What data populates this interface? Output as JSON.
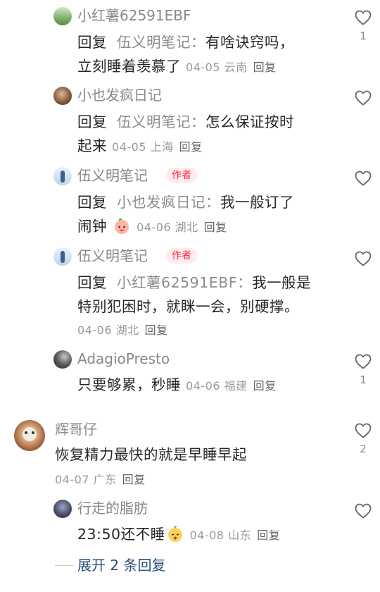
{
  "comments": [
    {
      "name": "小红薯62591EBF",
      "reply_word": "回复",
      "reply_to": "伍义明笔记",
      "line1_text": "有啥诀窍吗，",
      "line2_text": "立刻睡着羡慕了",
      "meta": "04-05 云南",
      "reply_btn": "回复",
      "likes": "1"
    },
    {
      "name": "小也发疯日记",
      "reply_word": "回复",
      "reply_to": "伍义明笔记",
      "line1_text": "怎么保证按时",
      "line2_text": "起来",
      "meta": "04-05 上海",
      "reply_btn": "回复",
      "likes": ""
    },
    {
      "name": "伍义明笔记",
      "badge": "作者",
      "reply_word": "回复",
      "reply_to": "小也发疯日记",
      "line1_text": "我一般订了",
      "line2_text": "闹钟",
      "meta": "04-06 湖北",
      "reply_btn": "回复",
      "likes": ""
    },
    {
      "name": "伍义明笔记",
      "badge": "作者",
      "reply_word": "回复",
      "reply_to": "小红薯62591EBF",
      "line1_text": "我一般是",
      "line2_text": "特别犯困时，就眯一会，别硬撑。",
      "meta": "04-06 湖北",
      "reply_btn": "回复",
      "likes": ""
    },
    {
      "name": "AdagioPresto",
      "text": "只要够累，秒睡",
      "meta": "04-06 福建",
      "reply_btn": "回复",
      "likes": "1"
    },
    {
      "name": "辉哥仔",
      "text": "恢复精力最快的就是早睡早起",
      "meta": "04-07 广东",
      "reply_btn": "回复",
      "likes": "2"
    },
    {
      "name": "行走的脂肪",
      "text": "23:50还不睡",
      "meta": "04-08 山东",
      "reply_btn": "回复",
      "likes": ""
    }
  ],
  "colon": "：",
  "expand_label": "展开 2 条回复",
  "icons": {
    "like": "heart-outline-icon",
    "emoji": "face-emoji-icon"
  },
  "colors": {
    "author_badge": "#ff2442",
    "link_blue": "#2a4d7a"
  }
}
